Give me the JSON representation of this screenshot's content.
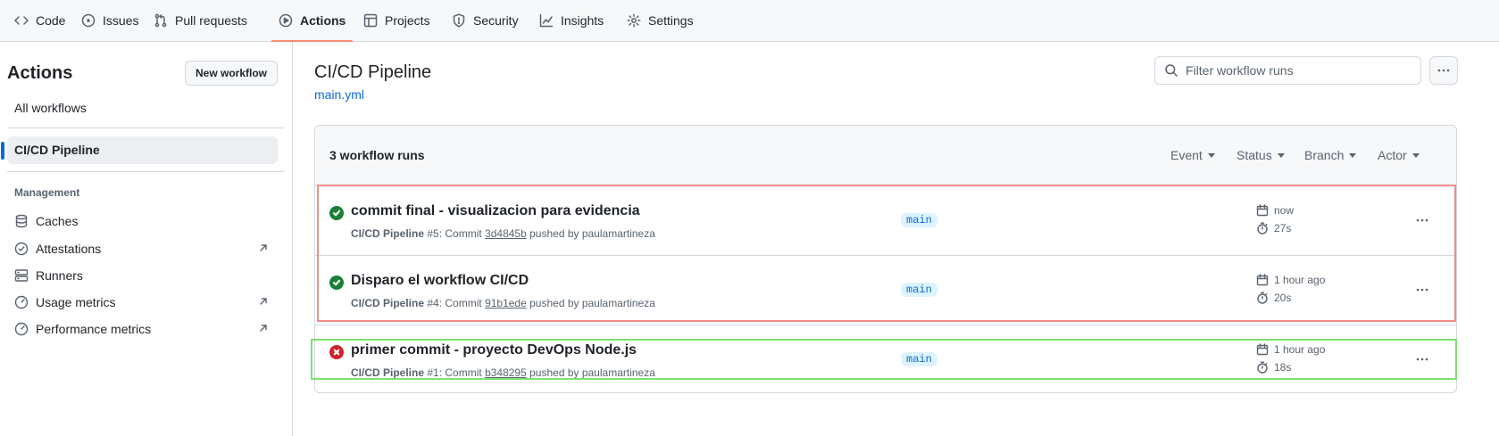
{
  "nav": {
    "tabs": [
      {
        "label": "Code",
        "icon": "code-icon"
      },
      {
        "label": "Issues",
        "icon": "issue-icon"
      },
      {
        "label": "Pull requests",
        "icon": "pull-request-icon"
      },
      {
        "label": "Actions",
        "icon": "play-icon",
        "active": true
      },
      {
        "label": "Projects",
        "icon": "table-icon"
      },
      {
        "label": "Security",
        "icon": "shield-icon"
      },
      {
        "label": "Insights",
        "icon": "graph-icon"
      },
      {
        "label": "Settings",
        "icon": "gear-icon"
      }
    ]
  },
  "sidebar": {
    "title": "Actions",
    "new_workflow": "New workflow",
    "all_workflows": "All workflows",
    "selected_workflow": "CI/CD Pipeline",
    "management_heading": "Management",
    "management_items": [
      {
        "label": "Caches",
        "icon": "database-icon",
        "external": false
      },
      {
        "label": "Attestations",
        "icon": "verified-icon",
        "external": true
      },
      {
        "label": "Runners",
        "icon": "server-icon",
        "external": false
      },
      {
        "label": "Usage metrics",
        "icon": "meter-icon",
        "external": true
      },
      {
        "label": "Performance metrics",
        "icon": "meter-icon",
        "external": true
      }
    ]
  },
  "main": {
    "workflow_title": "CI/CD Pipeline",
    "workflow_file": "main.yml",
    "filter_placeholder": "Filter workflow runs",
    "runs_count": "3 workflow runs",
    "filters": [
      "Event",
      "Status",
      "Branch",
      "Actor"
    ],
    "runs": [
      {
        "status": "success",
        "title": "commit final - visualizacion para evidencia",
        "workflow": "CI/CD Pipeline",
        "run_number": "#5",
        "commit_prefix": ": Commit",
        "sha": "3d4845b",
        "pushed_by": "pushed by paulamartineza",
        "branch": "main",
        "when": "now",
        "duration": "27s"
      },
      {
        "status": "success",
        "title": "Disparo el workflow CI/CD",
        "workflow": "CI/CD Pipeline",
        "run_number": "#4",
        "commit_prefix": ": Commit",
        "sha": "91b1ede",
        "pushed_by": "pushed by paulamartineza",
        "branch": "main",
        "when": "1 hour ago",
        "duration": "20s"
      },
      {
        "status": "failure",
        "title": "primer commit - proyecto DevOps Node.js",
        "workflow": "CI/CD Pipeline",
        "run_number": "#1",
        "commit_prefix": ": Commit",
        "sha": "b348295",
        "pushed_by": "pushed by paulamartineza",
        "branch": "main",
        "when": "1 hour ago",
        "duration": "18s"
      }
    ]
  },
  "colors": {
    "success": "#1a7f37",
    "failure": "#cf222e",
    "accent": "#0969da",
    "active_tab_underline": "#fd8c73",
    "highlight_red": "#f28b8b",
    "highlight_green": "#7ee06f"
  }
}
